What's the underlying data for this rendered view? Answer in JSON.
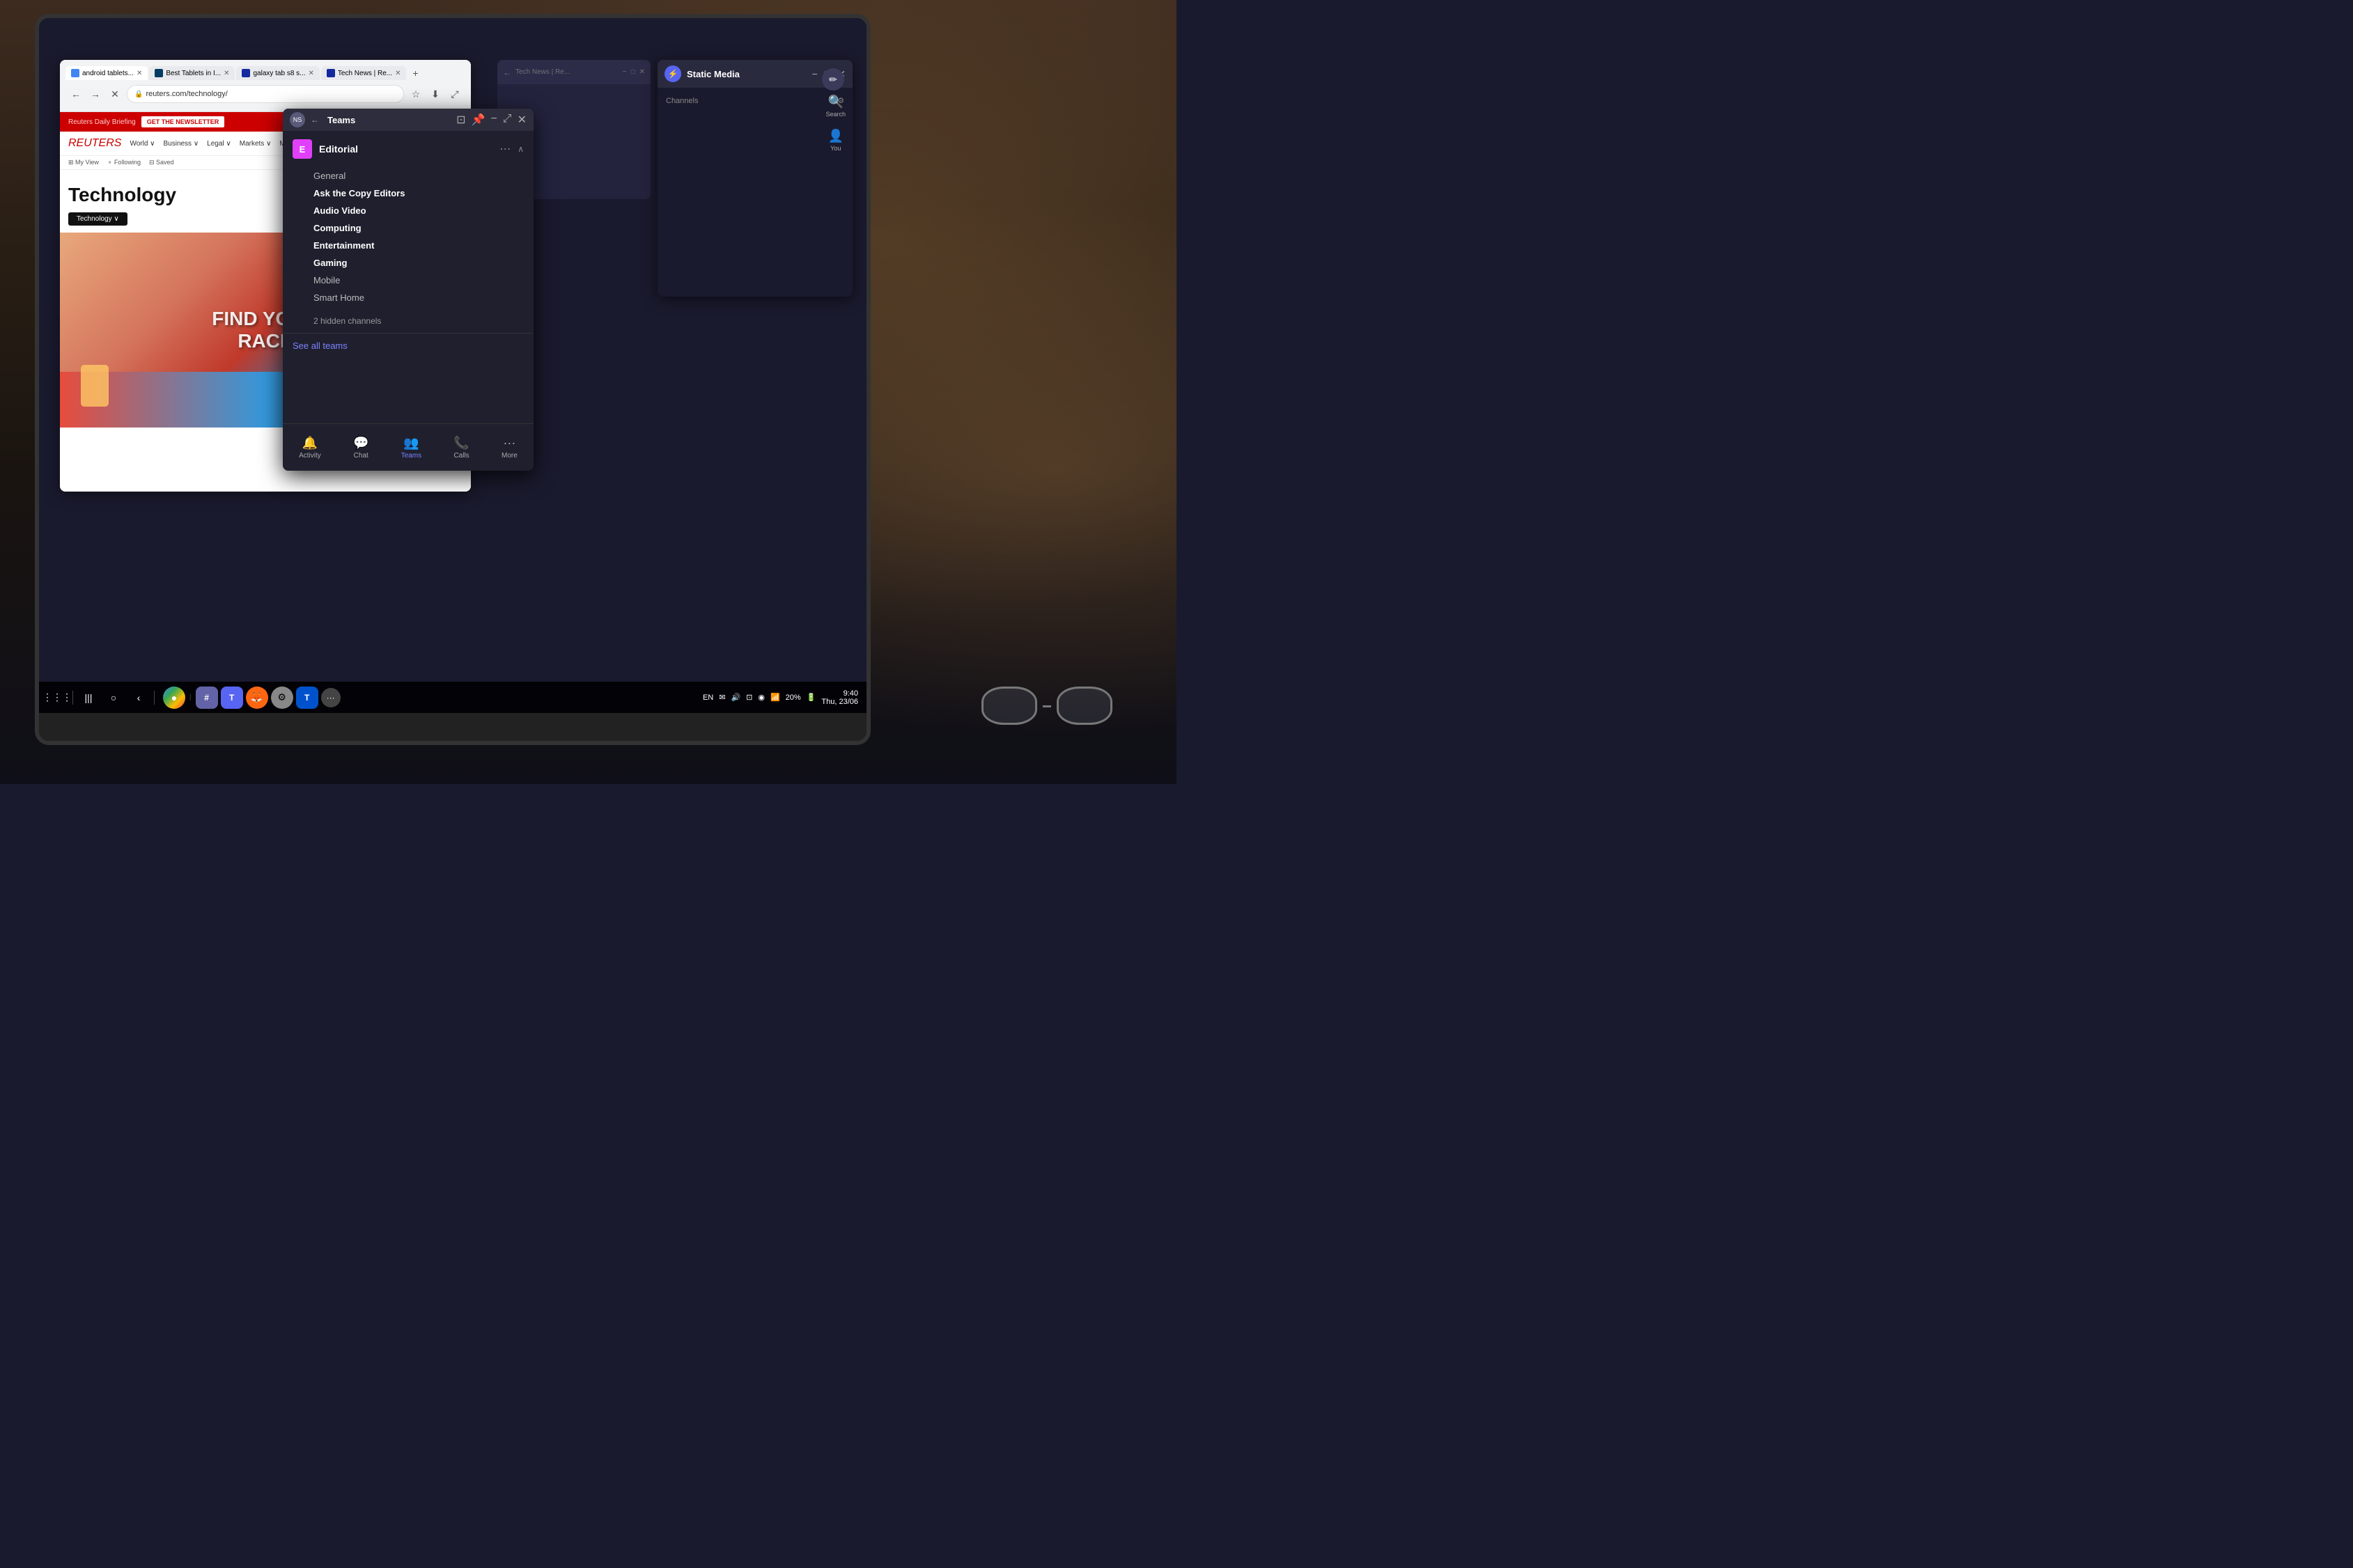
{
  "background": {
    "description": "Cafe background with laptop on table"
  },
  "browser_reuters": {
    "title": "Reuters Technology",
    "tabs": [
      {
        "label": "android tablets...",
        "active": true,
        "icon": "docs"
      },
      {
        "label": "Best Tablets in I...",
        "active": false,
        "icon": "bestbuy"
      },
      {
        "label": "galaxy tab s8 s...",
        "active": false,
        "icon": "samsung"
      },
      {
        "label": "Tech News | Re...",
        "active": false,
        "icon": "samsung"
      }
    ],
    "address": "reuters.com/technology/",
    "back_btn": "←",
    "forward_btn": "→",
    "close_btn": "✕",
    "refresh_btn": "↺",
    "daily_briefing": "Reuters Daily Briefing",
    "newsletter_btn": "GET THE NEWSLETTER",
    "nav_items": [
      "World ∨",
      "Business ∨",
      "Legal ∨",
      "Markets ∨",
      "More ∨"
    ],
    "subnav_items": [
      "⊞ My View",
      "⚬ Following",
      "⊟ Saved"
    ],
    "hero_title": "Technology",
    "hero_category_btn": "Technology ∨",
    "find_your_race_text": "FIND YOUR RACE"
  },
  "teams_modal": {
    "title": "Teams",
    "avatar_initials": "NS",
    "window_controls": [
      "−",
      "□",
      "✕"
    ],
    "editorial": {
      "icon_letter": "E",
      "name": "Editorial",
      "channels": [
        {
          "label": "General",
          "bold": false
        },
        {
          "label": "Ask the Copy Editors",
          "bold": true
        },
        {
          "label": "Audio Video",
          "bold": true
        },
        {
          "label": "Computing",
          "bold": true
        },
        {
          "label": "Entertainment",
          "bold": true
        },
        {
          "label": "Gaming",
          "bold": true
        },
        {
          "label": "Mobile",
          "bold": false
        },
        {
          "label": "Smart Home",
          "bold": false
        }
      ],
      "hidden_channels": "2 hidden channels"
    },
    "see_all_teams": "See all teams",
    "bottom_nav": [
      {
        "label": "Activity",
        "icon": "🔔",
        "active": false
      },
      {
        "label": "Chat",
        "icon": "💬",
        "active": false
      },
      {
        "label": "Teams",
        "icon": "👥",
        "active": true
      },
      {
        "label": "Calls",
        "icon": "📞",
        "active": false
      },
      {
        "label": "More",
        "icon": "···",
        "active": false
      }
    ]
  },
  "static_media_panel": {
    "title": "Static Media",
    "logo_icon": "⚡",
    "channels_label": "Channels",
    "controls": [
      "□",
      "−",
      "✕"
    ]
  },
  "system_bar": {
    "nav_buttons": [
      "⋮⋮⋮",
      "|",
      "|||",
      "○",
      "‹"
    ],
    "apps": [
      {
        "name": "Chrome",
        "icon": "●"
      },
      {
        "name": "Slack/Teams",
        "icon": "#"
      },
      {
        "name": "Microsoft Teams",
        "icon": "T"
      },
      {
        "name": "Firefox",
        "icon": "🦊"
      },
      {
        "name": "Settings",
        "icon": "⚙"
      },
      {
        "name": "Trello",
        "icon": "T"
      },
      {
        "name": "More",
        "icon": "···"
      }
    ],
    "status_items": [
      "EN",
      "✉",
      "🔊",
      "⊡",
      "◉",
      "WiFi",
      "20%",
      "🔋"
    ],
    "time": "9:40",
    "date": "Thu, 23/06"
  },
  "right_panel": {
    "search_label": "Search",
    "you_label": "You",
    "compose_icon": "✏"
  }
}
